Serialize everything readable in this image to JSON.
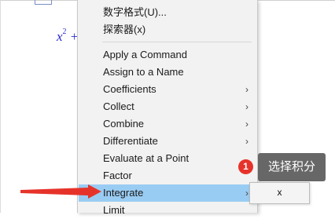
{
  "document": {
    "expression": {
      "base": "x",
      "exponent": "2",
      "operator": "+"
    }
  },
  "context_menu": {
    "items_top": [
      {
        "label": "数字格式(U)..."
      },
      {
        "label": "探索器(x)"
      }
    ],
    "items_main": [
      {
        "label": "Apply a Command",
        "has_submenu": false
      },
      {
        "label": "Assign to a Name",
        "has_submenu": false
      },
      {
        "label": "Coefficients",
        "has_submenu": true
      },
      {
        "label": "Collect",
        "has_submenu": true
      },
      {
        "label": "Combine",
        "has_submenu": true
      },
      {
        "label": "Differentiate",
        "has_submenu": true
      },
      {
        "label": "Evaluate at a Point",
        "has_submenu": false
      },
      {
        "label": "Factor",
        "has_submenu": false
      },
      {
        "label": "Integrate",
        "has_submenu": true,
        "highlighted": true
      },
      {
        "label": "Limit",
        "has_submenu": false
      }
    ],
    "arrow_glyph": "›"
  },
  "submenu": {
    "item_label": "x"
  },
  "annotation": {
    "step_number": "1",
    "text": "选择积分",
    "badge_color": "#e6332a",
    "arrow_color": "#e6332a"
  },
  "colors": {
    "highlight": "#99ccf3",
    "menu_bg": "#f2f2f2",
    "expression": "#2a2ad0"
  }
}
